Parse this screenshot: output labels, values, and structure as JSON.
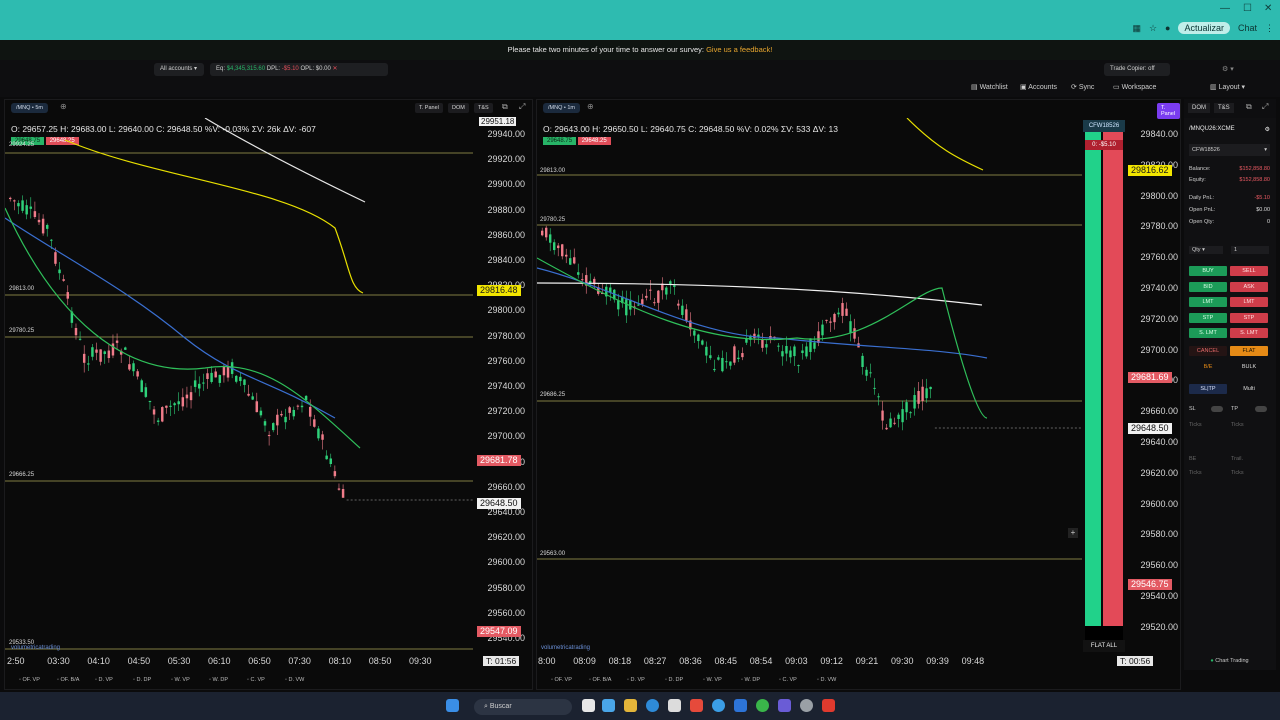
{
  "browser": {
    "update_label": "Actualizar",
    "chat_label": "Chat"
  },
  "survey": {
    "text": "Please take two minutes of your time to answer our survey:",
    "link": "Give us a feedback!"
  },
  "toolbar1": {
    "accounts": "All accounts",
    "eq_label": "Eq:",
    "eq_value": "$4,345,315.60",
    "dpl_label": "DPL:",
    "dpl_value": "-$5.10",
    "opl_label": "OPL:",
    "opl_value": "$0.00",
    "trade_copier": "Trade Copier: off"
  },
  "toolbar2": {
    "watchlist": "Watchlist",
    "accounts": "Accounts",
    "sync": "Sync",
    "workspace": "Workspace",
    "layout": "Layout"
  },
  "left_chart": {
    "symbol": "/MNQ • 5m",
    "tpanel": "T. Panel",
    "dom": "DOM",
    "ts": "T&S",
    "ohlc": "O: 29657.25  H: 29683.00  L: 29640.00  C: 29648.50  %V: -0.03%  ΣV: 26k  ΔV: -607",
    "ask_tag": "29648.75",
    "bid_tag": "29648.25",
    "y_ticks": [
      "29940.00",
      "29920.00",
      "29900.00",
      "29880.00",
      "29860.00",
      "29840.00",
      "29820.00",
      "29800.00",
      "29780.00",
      "29760.00",
      "29740.00",
      "29720.00",
      "29700.00",
      "29680.00",
      "29660.00",
      "29640.00",
      "29620.00",
      "29600.00",
      "29580.00",
      "29560.00",
      "29540.00"
    ],
    "y_top_partial": "29951.18",
    "levels": [
      "29924.25",
      "29813.00",
      "29780.25",
      "29666.25",
      "29533.50"
    ],
    "label_yellow": "29816.48",
    "label_red": "29681.78",
    "label_last": "29648.50",
    "label_red2": "29547.09",
    "x_ticks": [
      "2:50",
      "03:30",
      "04:10",
      "04:50",
      "05:30",
      "06:10",
      "06:50",
      "07:30",
      "08:10",
      "08:50",
      "09:30"
    ],
    "timer": "T: 01:56",
    "watermark": "volumetricatrading"
  },
  "right_chart": {
    "symbol": "/MNQ • 1m",
    "tpanel": "T. Panel",
    "dom": "DOM",
    "ts": "T&S",
    "ohlc": "O: 29643.00  H: 29650.50  L: 29640.75  C: 29648.50  %V: 0.02%  ΣV: 533  ΔV: 13",
    "ask_tag": "29648.75",
    "bid_tag": "29648.25",
    "y_ticks": [
      "29840.00",
      "29820.00",
      "29800.00",
      "29780.00",
      "29760.00",
      "29740.00",
      "29720.00",
      "29700.00",
      "29680.00",
      "29660.00",
      "29640.00",
      "29620.00",
      "29600.00",
      "29580.00",
      "29560.00",
      "29540.00",
      "29520.00"
    ],
    "levels": [
      "29813.00",
      "29780.25",
      "29686.25",
      "29563.00"
    ],
    "label_yellow": "29816.62",
    "label_red": "29681.69",
    "label_last": "29648.50",
    "label_red2": "29546.75",
    "x_ticks": [
      "8:00",
      "08:09",
      "08:18",
      "08:27",
      "08:36",
      "08:45",
      "08:54",
      "09:03",
      "09:12",
      "09:21",
      "09:30",
      "09:39",
      "09:48"
    ],
    "timer": "T: 00:56",
    "account_tag": "CFW18526",
    "pnl_tag": "0: -$5.10",
    "flat_all": "FLAT ALL",
    "watermark": "volumetricatrading"
  },
  "bottom_tabs": [
    "OF. VP",
    "OF. B/A",
    "D. VP",
    "D. DP",
    "W. VP",
    "W. DP",
    "C. VP",
    "D. VW"
  ],
  "right_panel": {
    "symbol": "/MNQU26:XCME",
    "account": "CFW18526",
    "balance_label": "Balance:",
    "balance": "$152,858.80",
    "equity_label": "Equity:",
    "equity": "$152,858.80",
    "daily_pnl_label": "Daily PnL:",
    "daily_pnl": "-$5.10",
    "open_pnl_label": "Open PnL:",
    "open_pnl": "$0.00",
    "open_qty_label": "Open Qty:",
    "open_qty": "0",
    "qty_label": "Qty",
    "qty": "1",
    "buy": "BUY",
    "sell": "SELL",
    "bid": "BID",
    "ask": "ASK",
    "lmt_b": "LMT",
    "lmt_s": "LMT",
    "stp_b": "STP",
    "stp_s": "STP",
    "slmt_b": "S. LMT",
    "slmt_s": "S. LMT",
    "cancel": "CANCEL",
    "flat": "FLAT",
    "be": "B/E",
    "bulk": "BULK",
    "sltp": "SL|TP",
    "multi": "Multi",
    "sl": "SL",
    "tp": "TP",
    "ticks": "Ticks",
    "be_lbl": "BE",
    "trail": "Trail.",
    "footer": "Chart Trading"
  },
  "taskbar": {
    "search": "Buscar"
  }
}
